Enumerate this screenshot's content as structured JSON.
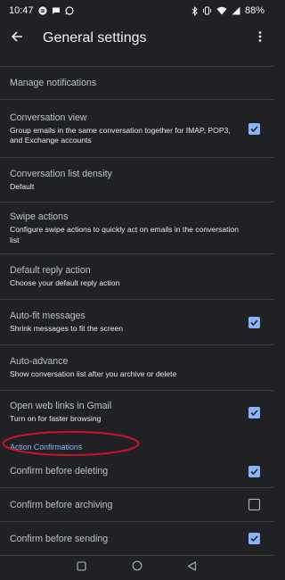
{
  "status_bar": {
    "time": "10:47",
    "battery": "88%",
    "icons_left": [
      "spotify-icon",
      "chat-icon",
      "whatsapp-icon"
    ],
    "icons_right": [
      "bluetooth-icon",
      "vibrate-icon",
      "wifi-icon",
      "signal-icon",
      "battery-icon"
    ]
  },
  "app_bar": {
    "title": "General settings",
    "back_icon": "arrow-left-icon",
    "more_icon": "more-vert-icon"
  },
  "settings": [
    {
      "title": "Manage notifications",
      "subtitle": "",
      "checkbox": null
    },
    {
      "title": "Conversation view",
      "subtitle": "Group emails in the same conversation together for IMAP, POP3, and Exchange accounts",
      "checkbox": true
    },
    {
      "title": "Conversation list density",
      "subtitle": "Default",
      "checkbox": null
    },
    {
      "title": "Swipe actions",
      "subtitle": "Configure swipe actions to quickly act on emails in the conversation list",
      "checkbox": null
    },
    {
      "title": "Default reply action",
      "subtitle": "Choose your default reply action",
      "checkbox": null
    },
    {
      "title": "Auto-fit messages",
      "subtitle": "Shrink messages to fit the screen",
      "checkbox": true
    },
    {
      "title": "Auto-advance",
      "subtitle": "Show conversation list after you archive or delete",
      "checkbox": null
    },
    {
      "title": "Open web links in Gmail",
      "subtitle": "Turn on for faster browsing",
      "checkbox": true
    }
  ],
  "section": {
    "label": "Action Confirmations"
  },
  "confirmations": [
    {
      "title": "Confirm before deleting",
      "checkbox": true
    },
    {
      "title": "Confirm before archiving",
      "checkbox": false
    },
    {
      "title": "Confirm before sending",
      "checkbox": true
    }
  ],
  "colors": {
    "background": "#202124",
    "accent": "#8ab4f8",
    "annotation": "#d0112b"
  },
  "nav_bar": {
    "icons": [
      "recents-square-icon",
      "home-circle-icon",
      "back-triangle-icon"
    ]
  }
}
